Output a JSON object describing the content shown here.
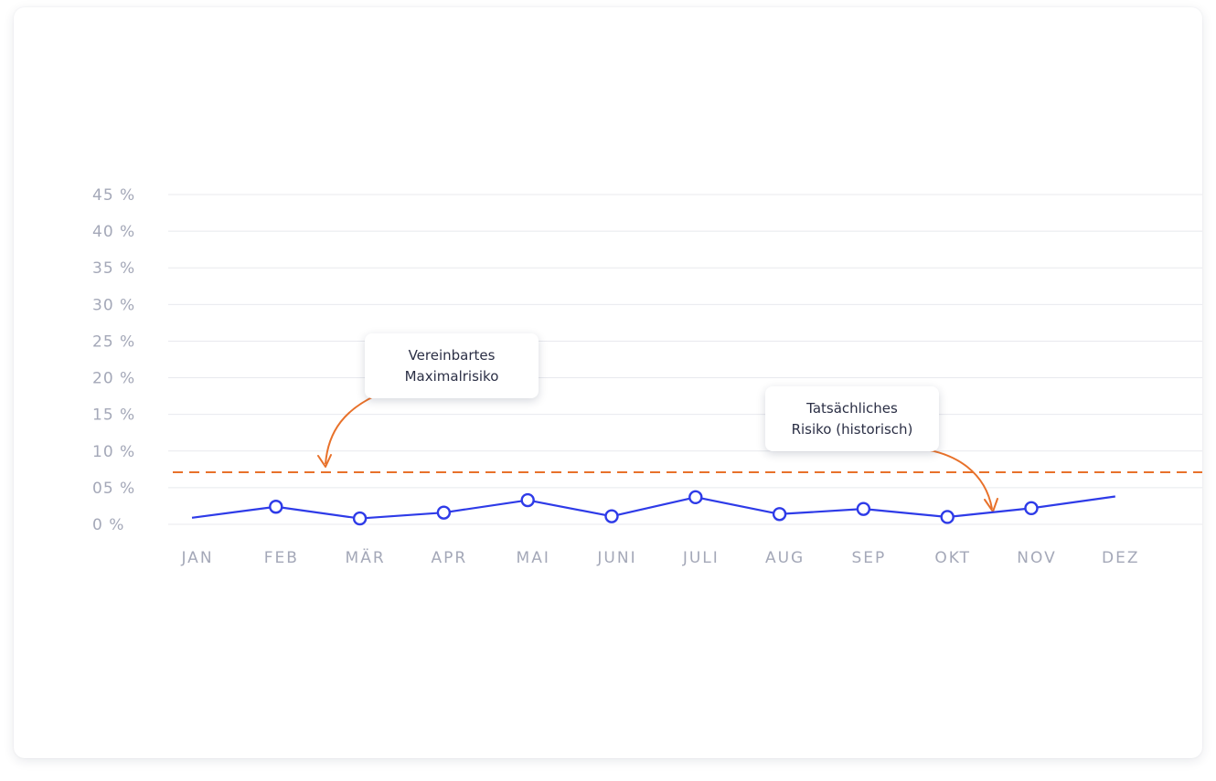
{
  "chart_data": {
    "type": "line",
    "categories": [
      "JAN",
      "FEB",
      "MÄR",
      "APR",
      "MAI",
      "JUNI",
      "JULI",
      "AUG",
      "SEP",
      "OKT",
      "NOV",
      "DEZ"
    ],
    "y_tick_labels": [
      "0 %",
      "05 %",
      "10 %",
      "15 %",
      "20 %",
      "25 %",
      "30 %",
      "35 %",
      "40 %",
      "45 %"
    ],
    "y_ticks": [
      0,
      5,
      10,
      15,
      20,
      25,
      30,
      35,
      40,
      45
    ],
    "ylim": [
      0,
      45
    ],
    "grid": true,
    "series": [
      {
        "values": [
          0.9,
          2.4,
          0.8,
          1.6,
          3.3,
          1.1,
          3.7,
          1.4,
          2.1,
          1.0,
          2.2,
          3.8
        ],
        "color": "#2e3be8",
        "markers": [
          false,
          true,
          true,
          true,
          true,
          true,
          true,
          true,
          true,
          true,
          true,
          false
        ]
      }
    ],
    "reference_line": {
      "value": 7.1,
      "color": "#e8712a",
      "style": "dashed"
    },
    "annotations": [
      {
        "lines": [
          "Vereinbartes",
          "Maximalrisiko"
        ]
      },
      {
        "lines": [
          "Tatsächliches",
          "Risiko (historisch)"
        ]
      }
    ]
  }
}
